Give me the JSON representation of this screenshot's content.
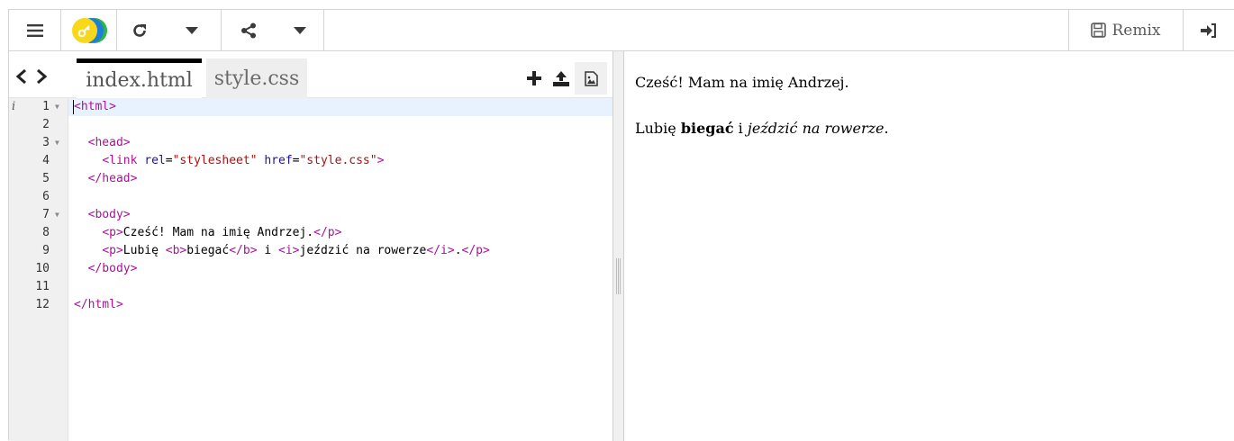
{
  "toolbar": {
    "remix_label": "Remix",
    "icons": [
      "menu-icon",
      "logo-icon",
      "reload-icon",
      "dropdown-icon",
      "share-icon",
      "share-dropdown-icon",
      "save-icon",
      "login-icon"
    ]
  },
  "editor": {
    "tabs": [
      {
        "label": "index.html",
        "active": true
      },
      {
        "label": "style.css",
        "active": false
      }
    ],
    "gutter_info": "i",
    "line_numbers": [
      "1",
      "2",
      "3",
      "4",
      "5",
      "6",
      "7",
      "8",
      "9",
      "10",
      "11",
      "12"
    ],
    "code_lines": [
      "<html>",
      "",
      "  <head>",
      "    <link rel=\"stylesheet\" href=\"style.css\">",
      "  </head>",
      "",
      "  <body>",
      "    <p>Cześć! Mam na imię Andrzej.</p>",
      "    <p>Lubię <b>biegać</b> i <i>jeździć na rowerze</i>.</p>",
      "  </body>",
      "",
      "</html>"
    ]
  },
  "preview": {
    "paragraph1": "Cześć! Mam na imię Andrzej.",
    "p2_before": "Lubię ",
    "p2_bold": "biegać",
    "p2_middle": " i ",
    "p2_italic": "jeździć na rowerze",
    "p2_end": "."
  },
  "colors": {
    "tag": "#aa1199",
    "attribute": "#221199",
    "string": "#aa1111",
    "active_line": "#e8f2ff",
    "logo_yellow": "#f9d81b",
    "logo_blue": "#1e7fd6",
    "logo_green": "#2fb34a"
  }
}
